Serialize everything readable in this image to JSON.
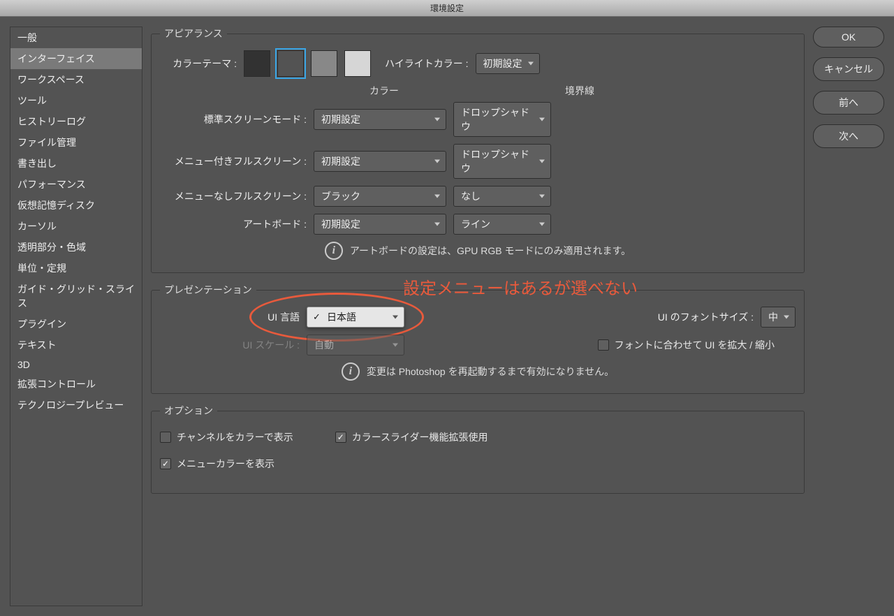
{
  "window": {
    "title": "環境設定"
  },
  "sidebar": {
    "items": [
      "一般",
      "インターフェイス",
      "ワークスペース",
      "ツール",
      "ヒストリーログ",
      "ファイル管理",
      "書き出し",
      "パフォーマンス",
      "仮想記憶ディスク",
      "カーソル",
      "透明部分・色域",
      "単位・定規",
      "ガイド・グリッド・スライス",
      "プラグイン",
      "テキスト",
      "3D",
      "拡張コントロール",
      "テクノロジープレビュー"
    ],
    "selected": 1
  },
  "buttons": {
    "ok": "OK",
    "cancel": "キャンセル",
    "prev": "前へ",
    "next": "次へ"
  },
  "appearance": {
    "legend": "アピアランス",
    "color_theme_label": "カラーテーマ :",
    "swatches": [
      "#323232",
      "#535353",
      "#888888",
      "#d6d6d6"
    ],
    "swatch_selected": 1,
    "highlight_label": "ハイライトカラー :",
    "highlight_value": "初期設定",
    "head_color": "カラー",
    "head_border": "境界線",
    "rows": [
      {
        "label": "標準スクリーンモード :",
        "color": "初期設定",
        "border": "ドロップシャドウ"
      },
      {
        "label": "メニュー付きフルスクリーン :",
        "color": "初期設定",
        "border": "ドロップシャドウ"
      },
      {
        "label": "メニューなしフルスクリーン :",
        "color": "ブラック",
        "border": "なし"
      },
      {
        "label": "アートボード :",
        "color": "初期設定",
        "border": "ライン"
      }
    ],
    "info": "アートボードの設定は、GPU RGB モードにのみ適用されます。"
  },
  "presentation": {
    "legend": "プレゼンテーション",
    "ui_lang_label": "UI 言語",
    "ui_lang_value": "日本語",
    "ui_scale_label": "UI スケール :",
    "ui_scale_value": "自動",
    "font_size_label": "UI のフォントサイズ :",
    "font_size_value": "中",
    "scale_to_font_label": "フォントに合わせて UI を拡大 / 縮小",
    "info": "変更は Photoshop を再起動するまで有効になりません。"
  },
  "options": {
    "legend": "オプション",
    "channel_color": "チャンネルをカラーで表示",
    "color_slider": "カラースライダー機能拡張使用",
    "menu_color": "メニューカラーを表示"
  },
  "annotation": {
    "text": "設定メニューはあるが選べない"
  }
}
